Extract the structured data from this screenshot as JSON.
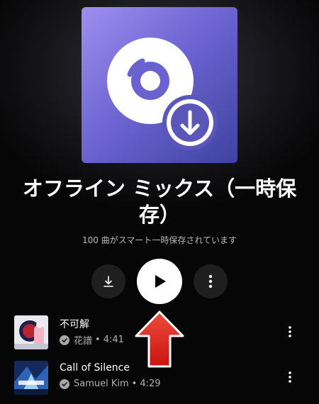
{
  "playlist": {
    "title": "オフライン ミックス（一時保存）",
    "subtitle": "100 曲がスマート一時保存されています",
    "album_icon": "disc-download-icon",
    "accent_gradient": [
      "#9f8ef0",
      "#6a62cf",
      "#3d43a0"
    ]
  },
  "actions": {
    "download_icon": "download-icon",
    "play_icon": "play-icon",
    "more_icon": "more-vert-icon"
  },
  "tracks": [
    {
      "title": "不可解",
      "artist": "花譜",
      "dot": "•",
      "duration": "4:41",
      "downloaded_icon": "check-circle-icon"
    },
    {
      "title": "Call of Silence",
      "artist": "Samuel Kim",
      "dot": "•",
      "duration": "4:29",
      "downloaded_icon": "check-circle-icon"
    }
  ],
  "annotation": {
    "icon": "red-up-arrow",
    "color": "#e01e16"
  }
}
